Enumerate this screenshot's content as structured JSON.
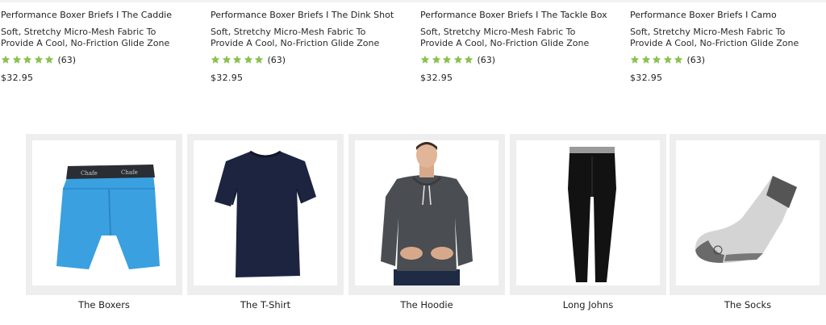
{
  "products": [
    {
      "title": "Performance Boxer Briefs I The Caddie",
      "description": "Soft, Stretchy Micro-Mesh Fabric To Provide A Cool, No-Friction Glide Zone",
      "rating_stars": 5,
      "rating_count": "(63)",
      "price": "$32.95"
    },
    {
      "title": "Performance Boxer Briefs I The Dink Shot",
      "description": "Soft, Stretchy Micro-Mesh Fabric To Provide A Cool, No-Friction Glide Zone",
      "rating_stars": 5,
      "rating_count": "(63)",
      "price": "$32.95"
    },
    {
      "title": "Performance Boxer Briefs I The Tackle Box",
      "description": "Soft, Stretchy Micro-Mesh Fabric To Provide A Cool, No-Friction Glide Zone",
      "rating_stars": 5,
      "rating_count": "(63)",
      "price": "$32.95"
    },
    {
      "title": "Performance Boxer Briefs I Camo",
      "description": "Soft, Stretchy Micro-Mesh Fabric To Provide A Cool, No-Friction Glide Zone",
      "rating_stars": 5,
      "rating_count": "(63)",
      "price": "$32.95"
    }
  ],
  "categories": [
    {
      "label": "The Boxers",
      "icon": "boxers-image"
    },
    {
      "label": "The T-Shirt",
      "icon": "tshirt-image"
    },
    {
      "label": "The Hoodie",
      "icon": "hoodie-image"
    },
    {
      "label": "Long Johns",
      "icon": "long-johns-image"
    },
    {
      "label": "The Socks",
      "icon": "socks-image"
    }
  ],
  "colors": {
    "star": "#8cc152",
    "tile_bg": "#eeeeee",
    "boxer_blue": "#3aa0e0",
    "navy": "#1c2440",
    "hoodie_gray": "#4a4d52"
  }
}
